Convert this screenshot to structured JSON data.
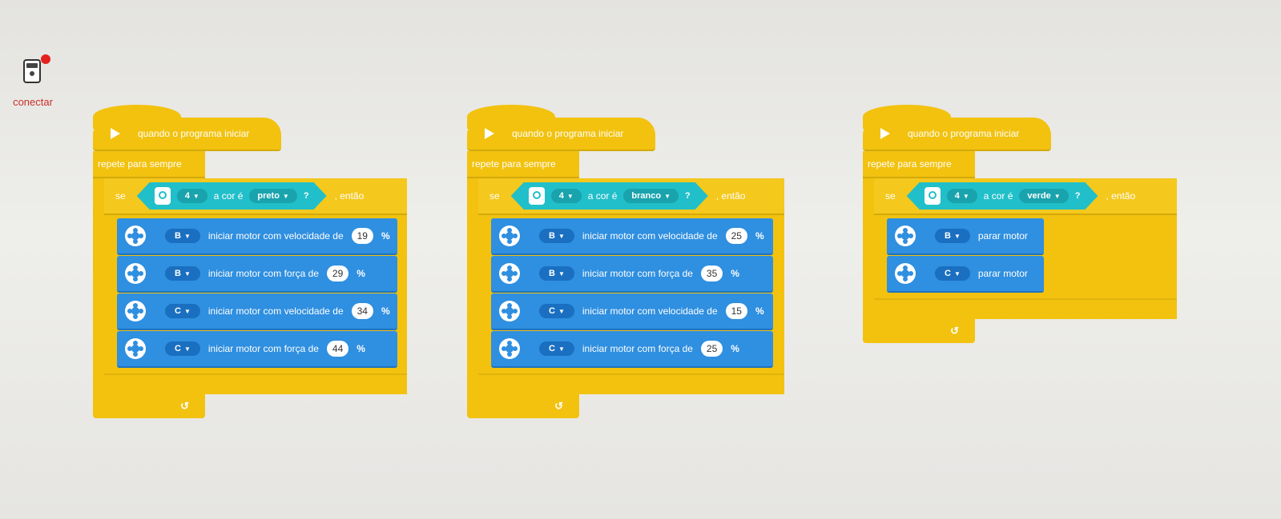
{
  "connect": {
    "label": "conectar"
  },
  "programs": [
    {
      "hat_label": "quando o programa iniciar",
      "repeat_label": "repete para sempre",
      "if_label": "se",
      "then_label": ", então",
      "sensor_port": "4",
      "color_prefix": "a cor é",
      "color": "preto",
      "question": "?",
      "blocks": [
        {
          "port": "B",
          "text": "iniciar motor com velocidade de",
          "value": "19",
          "unit": "%"
        },
        {
          "port": "B",
          "text": "iniciar motor com força de",
          "value": "29",
          "unit": "%"
        },
        {
          "port": "C",
          "text": "iniciar motor com velocidade de",
          "value": "34",
          "unit": "%"
        },
        {
          "port": "C",
          "text": "iniciar motor com força de",
          "value": "44",
          "unit": "%"
        }
      ]
    },
    {
      "hat_label": "quando o programa iniciar",
      "repeat_label": "repete para sempre",
      "if_label": "se",
      "then_label": ", então",
      "sensor_port": "4",
      "color_prefix": "a cor é",
      "color": "branco",
      "question": "?",
      "blocks": [
        {
          "port": "B",
          "text": "iniciar motor com velocidade de",
          "value": "25",
          "unit": "%"
        },
        {
          "port": "B",
          "text": "iniciar motor com força de",
          "value": "35",
          "unit": "%"
        },
        {
          "port": "C",
          "text": "iniciar motor com velocidade de",
          "value": "15",
          "unit": "%"
        },
        {
          "port": "C",
          "text": "iniciar motor com força de",
          "value": "25",
          "unit": "%"
        }
      ]
    },
    {
      "hat_label": "quando o programa iniciar",
      "repeat_label": "repete para sempre",
      "if_label": "se",
      "then_label": ", então",
      "sensor_port": "4",
      "color_prefix": "a cor é",
      "color": "verde",
      "question": "?",
      "blocks": [
        {
          "port": "B",
          "text": "parar motor"
        },
        {
          "port": "C",
          "text": "parar motor"
        }
      ]
    }
  ],
  "icons": {
    "hat": "play-icon",
    "sensor": "color-sensor-icon",
    "motor": "motor-icon",
    "dropdown": "caret-down-icon",
    "loop_end": "loop-arrow-icon"
  },
  "colors": {
    "control_yellow": "#f2c20f",
    "sensor_teal": "#21bfc9",
    "motor_blue": "#2f8fe0",
    "connect_red": "#e3221f"
  }
}
